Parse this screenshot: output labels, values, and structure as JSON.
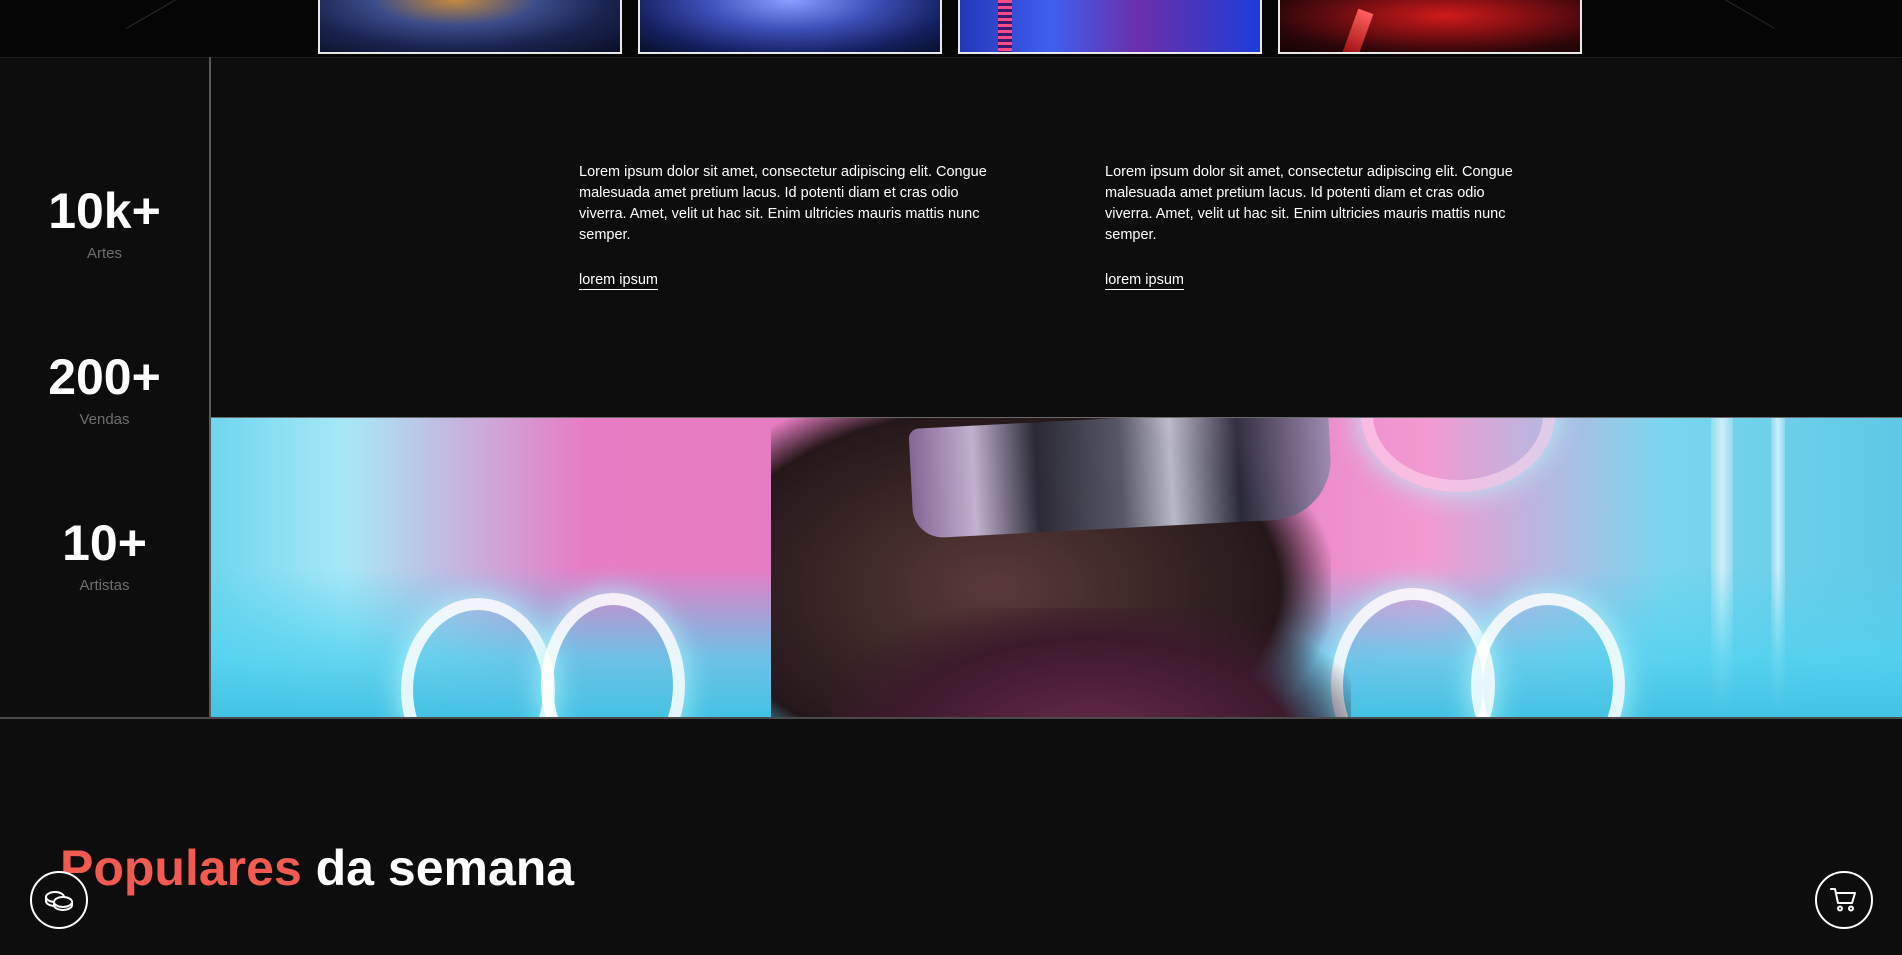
{
  "stats": [
    {
      "value": "10k+",
      "label": "Artes"
    },
    {
      "value": "200+",
      "label": "Vendas"
    },
    {
      "value": "10+",
      "label": "Artistas"
    }
  ],
  "columns": [
    {
      "text": "Lorem ipsum dolor sit amet, consectetur adipiscing elit. Congue malesuada amet pretium lacus. Id potenti diam et cras odio viverra. Amet, velit ut hac sit. Enim ultricies mauris mattis nunc semper.",
      "link": "lorem ipsum"
    },
    {
      "text": "Lorem ipsum dolor sit amet, consectetur adipiscing elit. Congue malesuada amet pretium lacus. Id potenti diam et cras odio viverra. Amet, velit ut hac sit. Enim ultricies mauris mattis nunc semper.",
      "link": "lorem ipsum"
    }
  ],
  "popular": {
    "accent": "Populares",
    "rest": " da semana"
  },
  "colors": {
    "accent": "#f35b52",
    "background": "#0d0d0d",
    "muted_label": "#6f6f6f"
  },
  "icons": {
    "left_fab": "coins-icon",
    "right_fab": "cart-icon"
  }
}
